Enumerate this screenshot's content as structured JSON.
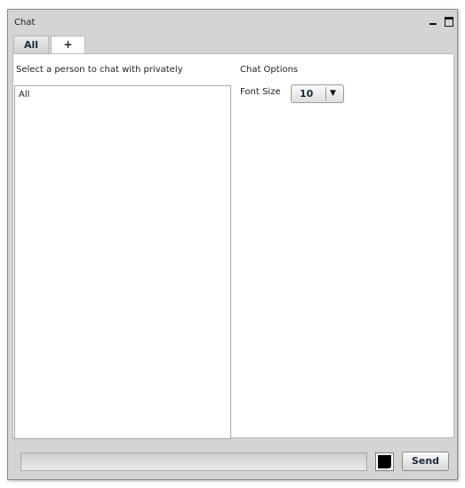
{
  "window": {
    "title": "Chat",
    "minimize_icon": "minimize-icon",
    "maximize_icon": "maximize-icon"
  },
  "tabs": [
    {
      "label": "All",
      "active": false
    },
    {
      "label": "+",
      "active": true
    }
  ],
  "people_panel": {
    "label": "Select a person to chat with privately",
    "items": [
      "All"
    ]
  },
  "options_panel": {
    "title": "Chat Options",
    "font_size_label": "Font Size",
    "font_size_value": "10",
    "dropdown_icon": "chevron-down-icon"
  },
  "composer": {
    "message_value": "",
    "text_color": "#000000",
    "send_label": "Send"
  },
  "colors": {
    "window_bg": "#d4d4d4",
    "panel_bg": "#ffffff",
    "text": "#222222",
    "accent_text": "#1a2a3a"
  }
}
